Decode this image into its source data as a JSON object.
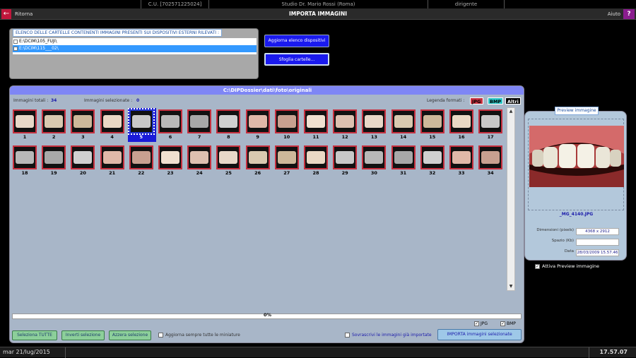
{
  "top_strip": {
    "code": "C.U. [702571225024]",
    "studio": "Studio Dr. Mario Rossi (Roma)",
    "role": "dirigente"
  },
  "titlebar": {
    "back_label": "Ritorna",
    "title": "IMPORTA IMMAGINI",
    "help_label": "Aiuto",
    "help_icon": "?"
  },
  "devices": {
    "title": "ELENCO DELLE CARTELLE CONTENENTI IMMAGINI PRESENTI SUI DISPOSITIVI ESTERNI RILEVATI :",
    "items": [
      {
        "label": "E:\\DCIM\\105_FUJI\\"
      },
      {
        "label": "E:\\DCIM\\115___02\\"
      }
    ],
    "refresh_button": "Aggiorna elenco dispositivi",
    "browse_button": "Sfoglia cartelle..."
  },
  "gallery": {
    "path": "C:\\DIPDossier\\dati\\foto\\originali",
    "total_label": "Immagini totali :",
    "total_value": "34",
    "selected_label": "Immagini selezionate :",
    "selected_value": "0",
    "legend_label": "Legenda formati :",
    "legend": [
      "JPG",
      "BMP",
      "Altri"
    ],
    "progress_text": "0%",
    "fmt_jpg": "JPG",
    "fmt_bmp": "BMP",
    "select_all": "Seleziona TUTTE",
    "invert": "Inverti selezione",
    "reset": "Azzera selezione",
    "refresh_thumbs": "Aggiorna sempre tutte le miniature",
    "overwrite": "Sovrascrivi le immagini già importate",
    "import_button": "IMPORTA immagini selezionate",
    "thumbs": [
      "1",
      "2",
      "3",
      "4",
      "5",
      "6",
      "7",
      "8",
      "9",
      "10",
      "11",
      "12",
      "13",
      "14",
      "15",
      "16",
      "17",
      "18",
      "19",
      "20",
      "21",
      "22",
      "23",
      "24",
      "25",
      "26",
      "27",
      "28",
      "29",
      "30",
      "31",
      "32",
      "33",
      "34"
    ]
  },
  "preview": {
    "tab": "Preview immagine",
    "filename": "_MG_4140.JPG",
    "dim_label": "Dimensioni (pixels)",
    "dim_value": "4368 x 2912",
    "space_label": "Spazio (Kb)",
    "space_value": "",
    "date_label": "Data",
    "date_value": "28/03/2009 15.57.46",
    "toggle_label": "Attiva Preview immagine"
  },
  "status": {
    "date": "mar 21/lug/2015",
    "time": "17.57.07"
  },
  "colors": {
    "accent_red": "#c0163b",
    "help_purple": "#8a1d8e",
    "header_blue": "#7e86f5",
    "panel": "#a8b6c8"
  }
}
